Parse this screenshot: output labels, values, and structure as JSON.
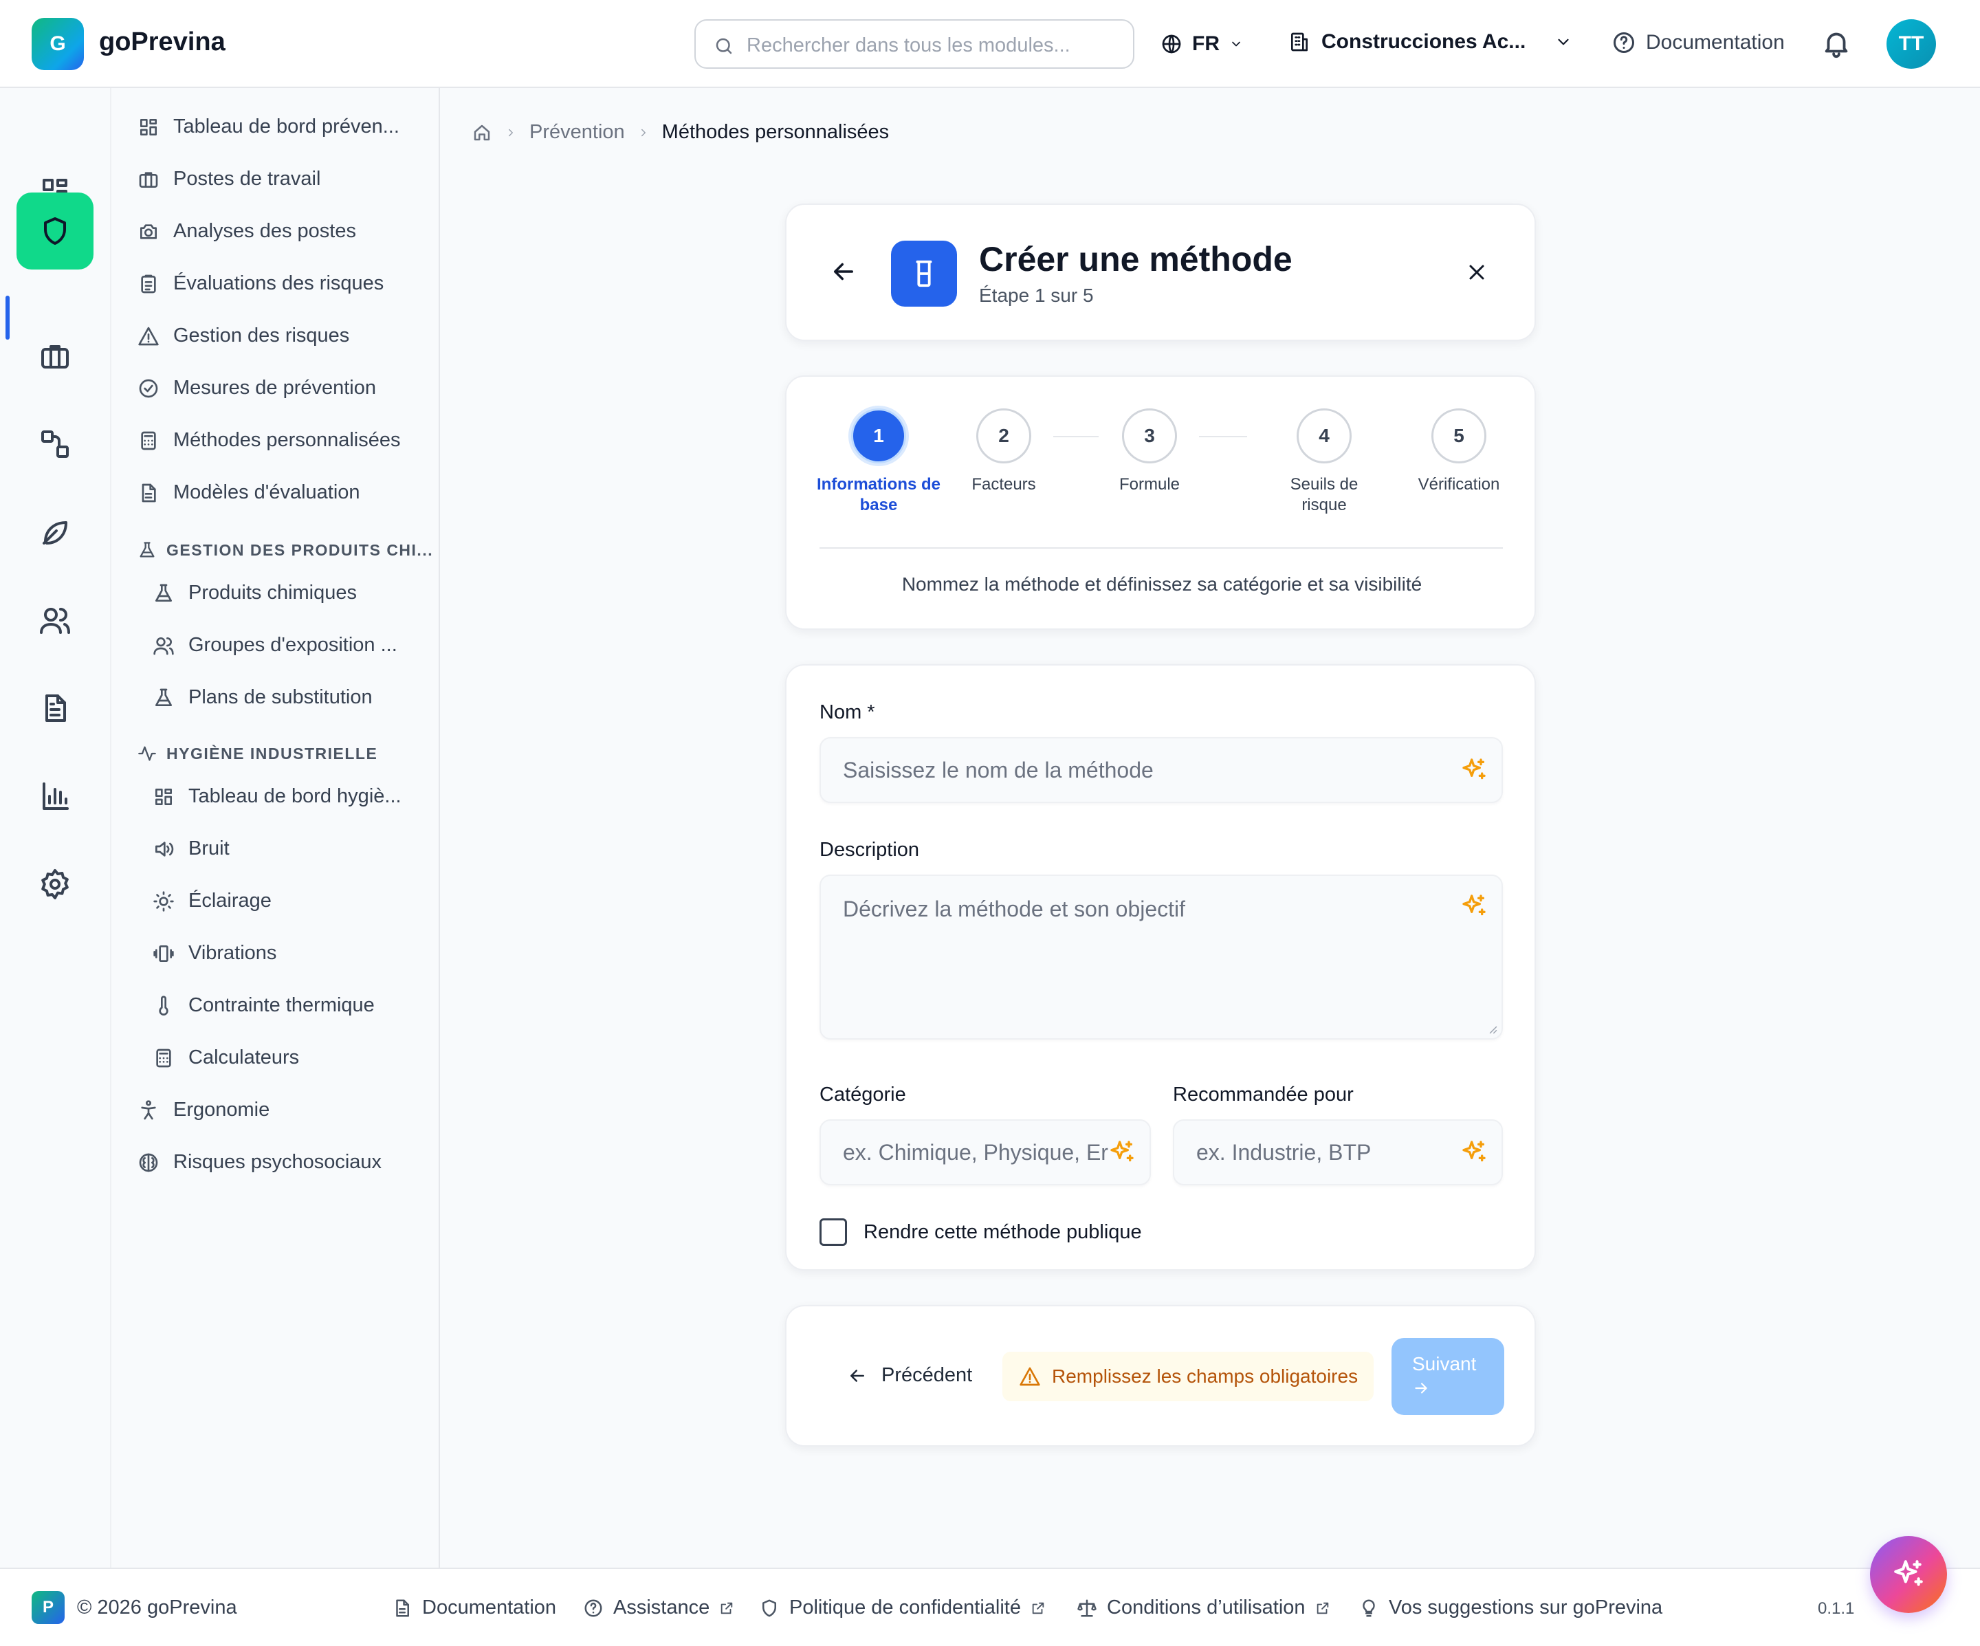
{
  "app": {
    "logo_letter": "G",
    "name": "goPrevina"
  },
  "header": {
    "search_placeholder": "Rechercher dans tous les modules...",
    "language": "FR",
    "company": "Construcciones Ac...",
    "documentation": "Documentation",
    "avatar_initials": "TT"
  },
  "sidebar": {
    "items": [
      "Tableau de bord préven...",
      "Postes de travail",
      "Analyses des postes",
      "Évaluations des risques",
      "Gestion des risques",
      "Mesures de prévention",
      "Méthodes personnalisées",
      "Modèles d'évaluation"
    ],
    "chem_heading": "GESTION DES PRODUITS CHI...",
    "chem_items": [
      "Produits chimiques",
      "Groupes d'exposition ...",
      "Plans de substitution"
    ],
    "hygiene_heading": "HYGIÈNE INDUSTRIELLE",
    "hygiene_items": [
      "Tableau de bord hygiè...",
      "Bruit",
      "Éclairage",
      "Vibrations",
      "Contrainte thermique",
      "Calculateurs"
    ],
    "bottom_items": [
      "Ergonomie",
      "Risques psychosociaux"
    ]
  },
  "breadcrumb": {
    "section": "Prévention",
    "current": "Méthodes personnalisées"
  },
  "wizard": {
    "title": "Créer une méthode",
    "subtitle": "Étape 1 sur 5",
    "steps": [
      {
        "number": "1",
        "label": "Informations de base"
      },
      {
        "number": "2",
        "label": "Facteurs"
      },
      {
        "number": "3",
        "label": "Formule"
      },
      {
        "number": "4",
        "label": "Seuils de risque"
      },
      {
        "number": "5",
        "label": "Vérification"
      }
    ],
    "active_step": 1,
    "step_description": "Nommez la méthode et définissez sa catégorie et sa visibilité"
  },
  "form": {
    "name_label": "Nom *",
    "name_placeholder": "Saisissez le nom de la méthode",
    "description_label": "Description",
    "description_placeholder": "Décrivez la méthode et son objectif",
    "category_label": "Catégorie",
    "category_placeholder": "ex. Chimique, Physique, Er",
    "recommended_label": "Recommandée pour",
    "recommended_placeholder": "ex. Industrie, BTP",
    "public_checkbox_label": "Rendre cette méthode publique",
    "public_checked": false
  },
  "actions": {
    "previous": "Précédent",
    "warning": "Remplissez les champs obligatoires",
    "next": "Suivant"
  },
  "footer": {
    "logo_letter": "P",
    "copyright": "© 2026 goPrevina",
    "documentation": "Documentation",
    "assistance": "Assistance",
    "privacy": "Politique de confidentialité",
    "terms": "Conditions d’utilisation",
    "suggestions": "Vos suggestions sur goPrevina",
    "version": "0.1.1"
  },
  "colors": {
    "accent_blue": "#2563eb",
    "active_green": "#10d98a",
    "warning": "#b45309",
    "sparkle": "#f59e0b",
    "next_disabled": "#93c5fd"
  }
}
